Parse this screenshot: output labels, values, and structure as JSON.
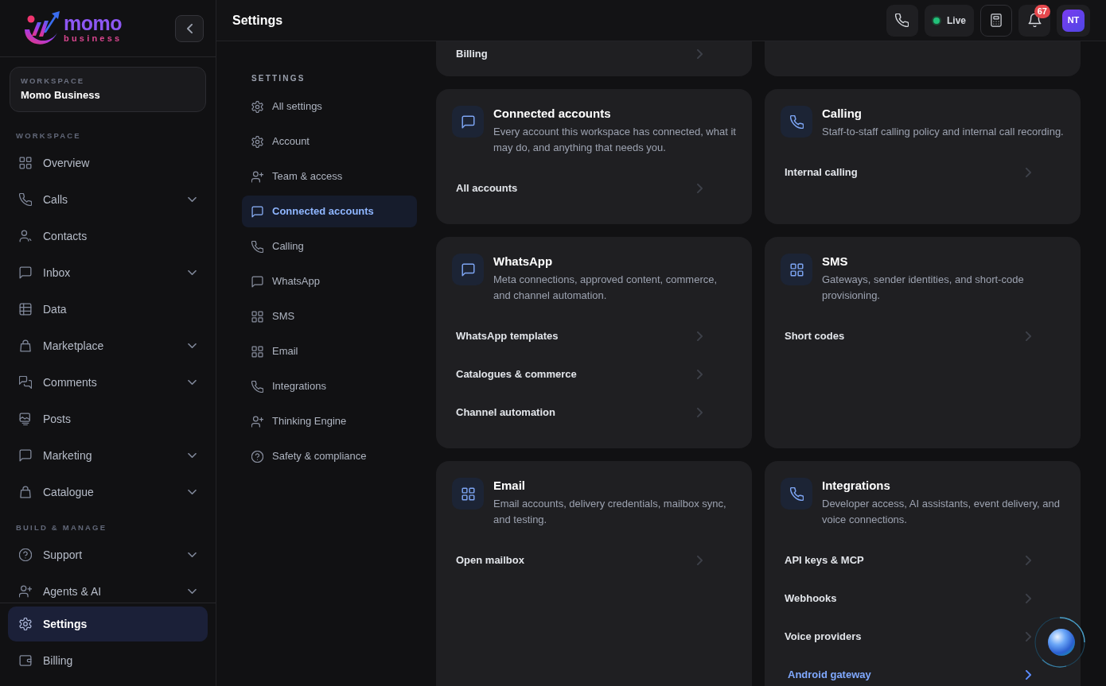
{
  "sidebar": {
    "logo": {
      "wordmark": "momo",
      "tagline": "business"
    },
    "workspace": {
      "label": "WORKSPACE",
      "name": "Momo Business"
    },
    "sections": [
      {
        "title": "WORKSPACE",
        "items": [
          {
            "label": "Overview",
            "kind": "link",
            "selected": false
          },
          {
            "label": "Calls",
            "kind": "group",
            "selected": false
          },
          {
            "label": "Contacts",
            "kind": "link",
            "selected": false
          },
          {
            "label": "Inbox",
            "kind": "group",
            "selected": false
          },
          {
            "label": "Data",
            "kind": "link",
            "selected": false
          },
          {
            "label": "Marketplace",
            "kind": "group",
            "selected": false
          },
          {
            "label": "Comments",
            "kind": "group",
            "selected": false
          },
          {
            "label": "Posts",
            "kind": "link",
            "selected": false
          },
          {
            "label": "Marketing",
            "kind": "group",
            "selected": false
          },
          {
            "label": "Catalogue",
            "kind": "group",
            "selected": false
          }
        ]
      },
      {
        "title": "BUILD & MANAGE",
        "items": [
          {
            "label": "Support",
            "kind": "group",
            "selected": false
          },
          {
            "label": "Agents & AI",
            "kind": "group",
            "selected": false
          }
        ]
      }
    ],
    "footer_items": [
      {
        "label": "Settings",
        "selected": true
      },
      {
        "label": "Billing",
        "selected": false
      }
    ]
  },
  "header": {
    "title": "Settings",
    "live": {
      "label": "Live"
    },
    "notifications": {
      "count": "67"
    },
    "avatar": {
      "initials": "NT"
    }
  },
  "settings_nav": {
    "title": "SETTINGS",
    "items": [
      {
        "label": "All settings",
        "selected": false
      },
      {
        "label": "Account",
        "selected": false
      },
      {
        "label": "Team & access",
        "selected": false
      },
      {
        "label": "Connected accounts",
        "selected": true
      },
      {
        "label": "Calling",
        "selected": false
      },
      {
        "label": "WhatsApp",
        "selected": false
      },
      {
        "label": "SMS",
        "selected": false
      },
      {
        "label": "Email",
        "selected": false
      },
      {
        "label": "Integrations",
        "selected": false
      },
      {
        "label": "Thinking Engine",
        "selected": false
      },
      {
        "label": "Safety & compliance",
        "selected": false
      }
    ]
  },
  "cards": [
    {
      "kind": "cut_off",
      "rows": [
        {
          "label": "Billing",
          "selected": false
        }
      ]
    },
    {
      "kind": "cut_off"
    },
    {
      "kind": "full",
      "title": "Connected accounts",
      "description": "Every account this workspace has connected, what it may do, and anything that needs you.",
      "rows": [
        {
          "label": "All accounts",
          "selected": false
        }
      ]
    },
    {
      "kind": "full",
      "title": "Calling",
      "description": "Staff-to-staff calling policy and internal call recording.",
      "rows": [
        {
          "label": "Internal calling",
          "selected": false
        }
      ]
    },
    {
      "kind": "full",
      "title": "WhatsApp",
      "description": "Meta connections, approved content, commerce, and channel automation.",
      "rows": [
        {
          "label": "WhatsApp templates",
          "selected": false
        },
        {
          "label": "Catalogues & commerce",
          "selected": false
        },
        {
          "label": "Channel automation",
          "selected": false
        }
      ]
    },
    {
      "kind": "full",
      "title": "SMS",
      "description": "Gateways, sender identities, and short-code provisioning.",
      "rows": [
        {
          "label": "Short codes",
          "selected": false
        }
      ]
    },
    {
      "kind": "full",
      "title": "Email",
      "description": "Email accounts, delivery credentials, mailbox sync, and testing.",
      "rows": [
        {
          "label": "Open mailbox",
          "selected": false
        }
      ]
    },
    {
      "kind": "full",
      "title": "Integrations",
      "description": "Developer access, AI assistants, event delivery, and voice connections.",
      "rows": [
        {
          "label": "API keys & MCP",
          "selected": false
        },
        {
          "label": "Webhooks",
          "selected": false
        },
        {
          "label": "Voice providers",
          "selected": false
        },
        {
          "label": "Android gateway",
          "selected": true
        }
      ]
    }
  ]
}
